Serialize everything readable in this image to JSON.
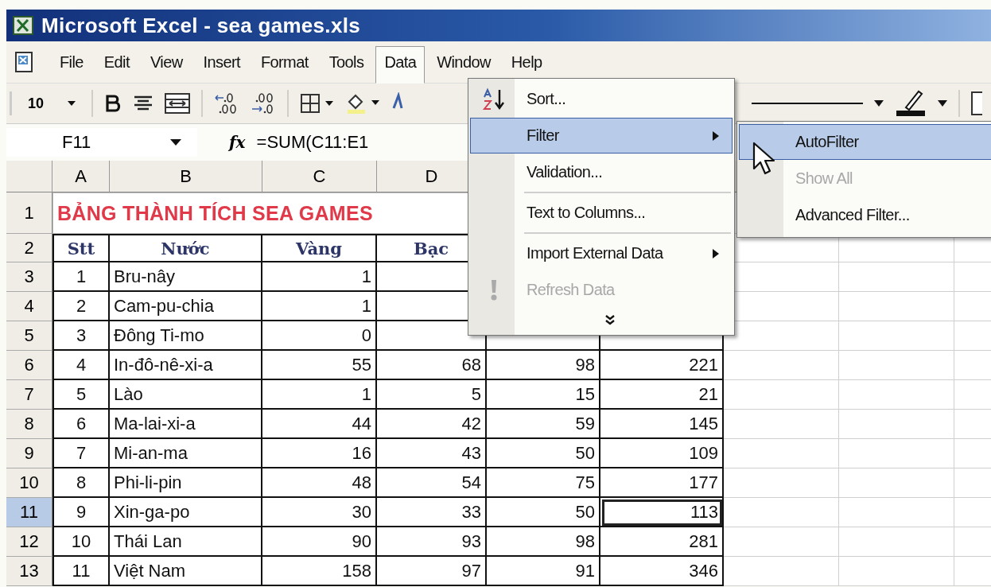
{
  "window": {
    "title": "Microsoft Excel - sea games.xls"
  },
  "menu_bar": [
    {
      "label": "File",
      "selected": false
    },
    {
      "label": "Edit",
      "selected": false
    },
    {
      "label": "View",
      "selected": false
    },
    {
      "label": "Insert",
      "selected": false
    },
    {
      "label": "Format",
      "selected": false
    },
    {
      "label": "Tools",
      "selected": false
    },
    {
      "label": "Data",
      "selected": true
    },
    {
      "label": "Window",
      "selected": false
    },
    {
      "label": "Help",
      "selected": false
    }
  ],
  "toolbar": {
    "font_size": "10"
  },
  "formula_bar": {
    "name_box": "F11",
    "function_label": "fx",
    "formula": "=SUM(C11:E1"
  },
  "sheet": {
    "columns": [
      {
        "label": "A"
      },
      {
        "label": "B"
      },
      {
        "label": "C"
      },
      {
        "label": "D"
      }
    ],
    "rows": [
      {
        "header": "1",
        "selected": false,
        "kind": "title",
        "title": "BẢNG THÀNH TÍCH SEA GAMES"
      },
      {
        "header": "2",
        "selected": false,
        "kind": "heading",
        "cells": [
          {
            "text": "Stt",
            "active": false
          },
          {
            "text": "Nước",
            "active": false
          },
          {
            "text": "Vàng",
            "active": false
          },
          {
            "text": "Bạc",
            "active": false
          }
        ]
      },
      {
        "header": "3",
        "selected": false,
        "kind": "data",
        "cells": [
          {
            "text": "1",
            "active": false
          },
          {
            "text": "Bru-nây",
            "active": false
          },
          {
            "text": "1",
            "active": false
          }
        ]
      },
      {
        "header": "4",
        "selected": false,
        "kind": "data",
        "cells": [
          {
            "text": "2",
            "active": false
          },
          {
            "text": "Cam-pu-chia",
            "active": false
          },
          {
            "text": "1",
            "active": false
          }
        ]
      },
      {
        "header": "5",
        "selected": false,
        "kind": "data",
        "cells": [
          {
            "text": "3",
            "active": false
          },
          {
            "text": "Đông Ti-mo",
            "active": false
          },
          {
            "text": "0",
            "active": false
          }
        ]
      },
      {
        "header": "6",
        "selected": false,
        "kind": "data",
        "cells": [
          {
            "text": "4",
            "active": false
          },
          {
            "text": "In-đô-nê-xi-a",
            "active": false
          },
          {
            "text": "55",
            "active": false
          },
          {
            "text": "68",
            "active": false
          },
          {
            "text": "98",
            "active": false
          },
          {
            "text": "221",
            "active": false
          }
        ]
      },
      {
        "header": "7",
        "selected": false,
        "kind": "data",
        "cells": [
          {
            "text": "5",
            "active": false
          },
          {
            "text": "Lào",
            "active": false
          },
          {
            "text": "1",
            "active": false
          },
          {
            "text": "5",
            "active": false
          },
          {
            "text": "15",
            "active": false
          },
          {
            "text": "21",
            "active": false
          }
        ]
      },
      {
        "header": "8",
        "selected": false,
        "kind": "data",
        "cells": [
          {
            "text": "6",
            "active": false
          },
          {
            "text": "Ma-lai-xi-a",
            "active": false
          },
          {
            "text": "44",
            "active": false
          },
          {
            "text": "42",
            "active": false
          },
          {
            "text": "59",
            "active": false
          },
          {
            "text": "145",
            "active": false
          }
        ]
      },
      {
        "header": "9",
        "selected": false,
        "kind": "data",
        "cells": [
          {
            "text": "7",
            "active": false
          },
          {
            "text": "Mi-an-ma",
            "active": false
          },
          {
            "text": "16",
            "active": false
          },
          {
            "text": "43",
            "active": false
          },
          {
            "text": "50",
            "active": false
          },
          {
            "text": "109",
            "active": false
          }
        ]
      },
      {
        "header": "10",
        "selected": false,
        "kind": "data",
        "cells": [
          {
            "text": "8",
            "active": false
          },
          {
            "text": "Phi-li-pin",
            "active": false
          },
          {
            "text": "48",
            "active": false
          },
          {
            "text": "54",
            "active": false
          },
          {
            "text": "75",
            "active": false
          },
          {
            "text": "177",
            "active": false
          }
        ]
      },
      {
        "header": "11",
        "selected": true,
        "kind": "data",
        "cells": [
          {
            "text": "9",
            "active": false
          },
          {
            "text": "Xin-ga-po",
            "active": false
          },
          {
            "text": "30",
            "active": false
          },
          {
            "text": "33",
            "active": false
          },
          {
            "text": "50",
            "active": false
          },
          {
            "text": "113",
            "active": true
          }
        ]
      },
      {
        "header": "12",
        "selected": false,
        "kind": "data",
        "cells": [
          {
            "text": "10",
            "active": false
          },
          {
            "text": "Thái Lan",
            "active": false
          },
          {
            "text": "90",
            "active": false
          },
          {
            "text": "93",
            "active": false
          },
          {
            "text": "98",
            "active": false
          },
          {
            "text": "281",
            "active": false
          }
        ]
      },
      {
        "header": "13",
        "selected": false,
        "kind": "data",
        "cells": [
          {
            "text": "11",
            "active": false
          },
          {
            "text": "Việt Nam",
            "active": false
          },
          {
            "text": "158",
            "active": false
          },
          {
            "text": "97",
            "active": false
          },
          {
            "text": "91",
            "active": false
          },
          {
            "text": "346",
            "active": false
          }
        ]
      }
    ]
  },
  "data_menu": {
    "items": [
      {
        "kind": "item",
        "label": "Sort...",
        "selected": false,
        "disabled": false,
        "submenu": false
      },
      {
        "kind": "item",
        "label": "Filter",
        "selected": true,
        "disabled": false,
        "submenu": true
      },
      {
        "kind": "item",
        "label": "Validation...",
        "selected": false,
        "disabled": false,
        "submenu": false
      },
      {
        "kind": "separator"
      },
      {
        "kind": "item",
        "label": "Text to Columns...",
        "selected": false,
        "disabled": false,
        "submenu": false
      },
      {
        "kind": "separator"
      },
      {
        "kind": "item",
        "label": "Import External Data",
        "selected": false,
        "disabled": false,
        "submenu": true
      },
      {
        "kind": "item",
        "label": "Refresh Data",
        "selected": false,
        "disabled": true,
        "submenu": false
      },
      {
        "kind": "more"
      }
    ]
  },
  "filter_submenu": {
    "items": [
      {
        "kind": "item",
        "label": "AutoFilter",
        "selected": true,
        "disabled": false,
        "submenu": false
      },
      {
        "kind": "item",
        "label": "Show All",
        "selected": false,
        "disabled": true,
        "submenu": false
      },
      {
        "kind": "item",
        "label": "Advanced Filter...",
        "selected": false,
        "disabled": false,
        "submenu": false
      }
    ]
  }
}
